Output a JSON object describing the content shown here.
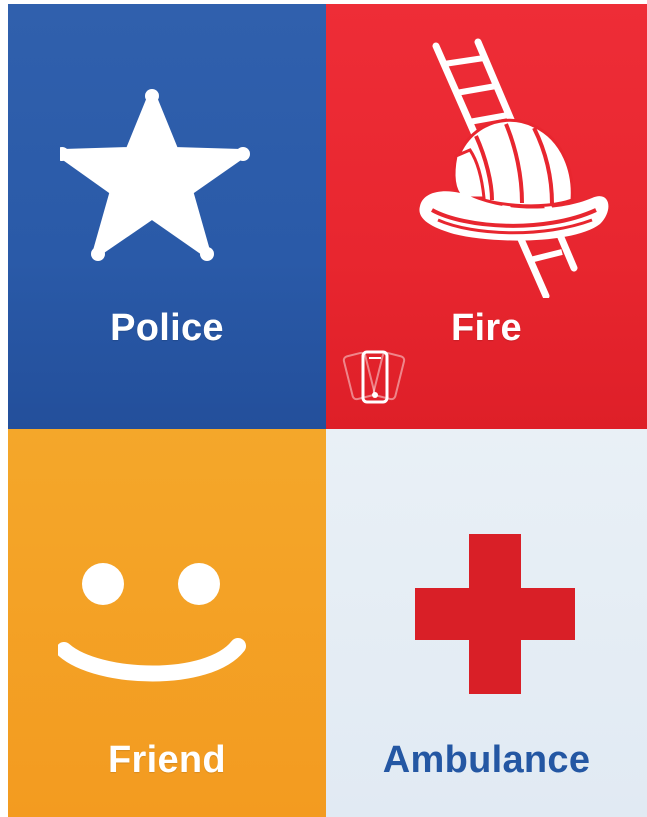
{
  "tiles": {
    "police": {
      "label": "Police",
      "icon": "star-badge-icon",
      "color": "#2b5ba9"
    },
    "fire": {
      "label": "Fire",
      "icon": "fire-helmet-ladder-icon",
      "color": "#e8262f",
      "secondary_icon": "shake-phone-icon"
    },
    "friend": {
      "label": "Friend",
      "icon": "smiley-icon",
      "color": "#f4a125"
    },
    "ambulance": {
      "label": "Ambulance",
      "icon": "red-cross-icon",
      "color": "#e3ecf4",
      "label_color": "#2457a3",
      "cross_color": "#d91f27"
    }
  }
}
